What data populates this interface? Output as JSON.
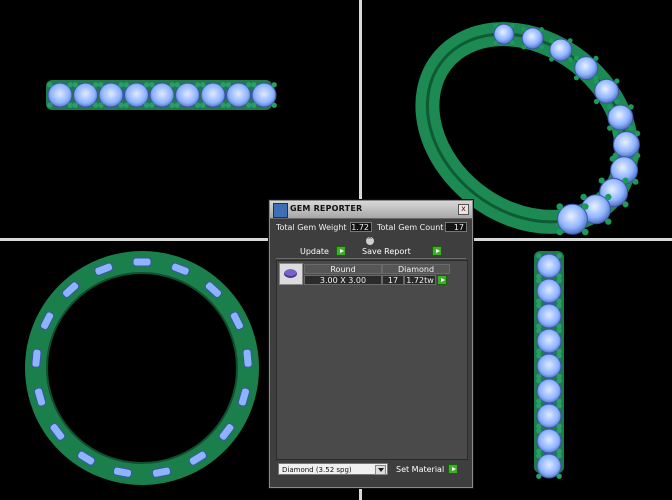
{
  "panel": {
    "title": "GEM REPORTER",
    "close_glyph": "x",
    "total_weight_label": "Total Gem Weight",
    "total_weight_value": "1.72",
    "total_count_label": "Total Gem Count",
    "total_count_value": "17",
    "update_label": "Update",
    "save_report_label": "Save Report",
    "collapse_glyph": "^",
    "gem_row": {
      "shape": "Round",
      "material": "Diamond",
      "size": "3.00 X 3.00",
      "count": "17",
      "weight": "1.72tw"
    },
    "material_select": "Diamond    (3.52 spg)",
    "set_material_label": "Set Material"
  },
  "colors": {
    "metal": "#1f8a55",
    "gem": "#8fb4ff",
    "divider": "#d8d8d8",
    "button_green": "#3fae2a"
  },
  "icons": [
    "gem-reporter-icon",
    "close-icon",
    "collapse-icon",
    "dropdown-arrow-icon",
    "play-icon"
  ]
}
